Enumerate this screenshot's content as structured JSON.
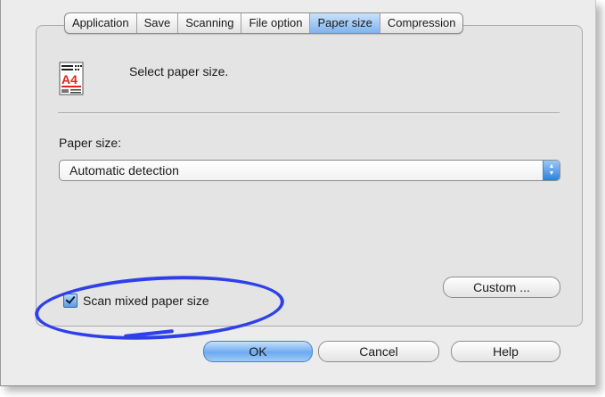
{
  "tabs": [
    {
      "label": "Application",
      "active": false
    },
    {
      "label": "Save",
      "active": false
    },
    {
      "label": "Scanning",
      "active": false
    },
    {
      "label": "File option",
      "active": false
    },
    {
      "label": "Paper size",
      "active": true
    },
    {
      "label": "Compression",
      "active": false
    }
  ],
  "header": {
    "icon_name": "a4-paper-icon",
    "icon_text": "A4",
    "text": "Select paper size."
  },
  "paper_size": {
    "label": "Paper size:",
    "selected": "Automatic detection"
  },
  "custom_button": "Custom ...",
  "mixed_checkbox": {
    "label": "Scan mixed paper size",
    "checked": true
  },
  "buttons": {
    "ok": "OK",
    "cancel": "Cancel",
    "help": "Help"
  },
  "colors": {
    "accent_blue": "#6eaaf0",
    "annotation_blue": "#2f40e8",
    "icon_red": "#e8231c"
  }
}
